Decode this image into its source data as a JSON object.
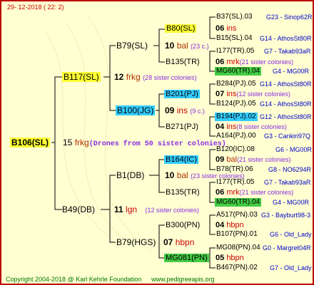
{
  "date": "29- 12-2018 ( 22:  2)",
  "copyright": "Copyright 2004-2018 @ Karl Kehrle Foundation",
  "site": "www.pedigreeapis.org",
  "colors": {
    "yellow": "#ffff33",
    "cyan": "#33ccff",
    "green": "#44cc44",
    "border": "#b80000"
  },
  "root": {
    "id": "B106(SL)",
    "num": "15",
    "mark": "frkg",
    "note": "(Drones from 50 sister colonies)"
  },
  "n1": {
    "id": "B117(SL)",
    "num": "12",
    "mark": "frkg",
    "note": "(28 sister colonies)"
  },
  "n2": {
    "id": "B49(DB)",
    "num": "11",
    "mark": "lgn",
    "note": "(12 sister colonies)"
  },
  "n11": {
    "id": "B79(SL)",
    "num": "10",
    "mark": "bal",
    "note": "(23 c.)"
  },
  "n12": {
    "id": "B100(JG)",
    "num": "09",
    "mark": "ins",
    "note": "(9 c.)"
  },
  "n21": {
    "id": "B1(DB)",
    "num": "10",
    "mark": "bal",
    "note": "(23 sister colonies)"
  },
  "n22": {
    "id": "B79(HGS)",
    "num": "07",
    "mark": "hbpn",
    "note": ""
  },
  "q1": {
    "id": "B80(SL)",
    "num": "06",
    "mark": "ins"
  },
  "q2": {
    "id": "B135(TR)",
    "num": "06",
    "mark": "mrk",
    "note": "(21 sister colonies)"
  },
  "q3": {
    "id": "B201(PJ)",
    "num": "07",
    "mark": "ins",
    "note": "(12 sister colonies)"
  },
  "q4": {
    "id": "B271(PJ)",
    "num": "04",
    "mark": "ins",
    "note": "(8 sister colonies)"
  },
  "q5": {
    "id": "B164(IC)",
    "num": "09",
    "mark": "bal",
    "note": "(21 sister colonies)"
  },
  "q6": {
    "id": "B135(TR)",
    "num": "06",
    "mark": "mrk",
    "note": "(21 sister colonies)"
  },
  "q7": {
    "id": "B300(PN)",
    "num": "04",
    "mark": "hbpn"
  },
  "q8": {
    "id": "MG081(PN)",
    "num": "05",
    "mark": "hbpn"
  },
  "g1a": {
    "id": "B37(SL).03",
    "tag": "G23 - Sinop62R"
  },
  "g1b": {
    "id": "B15(SL).04",
    "tag": "G14 - AthosSt80R"
  },
  "g2a": {
    "id": "I177(TR).05",
    "tag": "G7 - Takab93aR"
  },
  "g2b": {
    "id": "MG60(TR).04",
    "tag": "G4 - MG00R"
  },
  "g3a": {
    "id": "B284(PJ).05",
    "tag": "G14 - AthosSt80R"
  },
  "g3b": {
    "id": "B124(PJ).05",
    "tag": "G14 - AthosSt80R"
  },
  "g4a": {
    "id": "B194(PJ).02",
    "tag": "G12 - AthosSt80R"
  },
  "g4b": {
    "id": "A164(PJ).00",
    "tag": "G3 - Cankiri97Q"
  },
  "g5a": {
    "id": "B120(IC).08",
    "tag": "G6 - MG00R"
  },
  "g5b": {
    "id": "B78(TR).06",
    "tag": "G8 - NO6294R"
  },
  "g6a": {
    "id": "I177(TR).05",
    "tag": "G7 - Takab93aR"
  },
  "g6b": {
    "id": "MG60(TR).04",
    "tag": "G4 - MG00R"
  },
  "g7a": {
    "id": "A517(PN).03",
    "tag": "G3 - Bayburt98-3"
  },
  "g7b": {
    "id": "B107(PN).01",
    "tag": "G6 - Old_Lady"
  },
  "g8a": {
    "id": "MG08(PN).04",
    "tag": "G0 - Margret04R"
  },
  "g8b": {
    "id": "B467(PN).02",
    "tag": "G7 - Old_Lady"
  }
}
